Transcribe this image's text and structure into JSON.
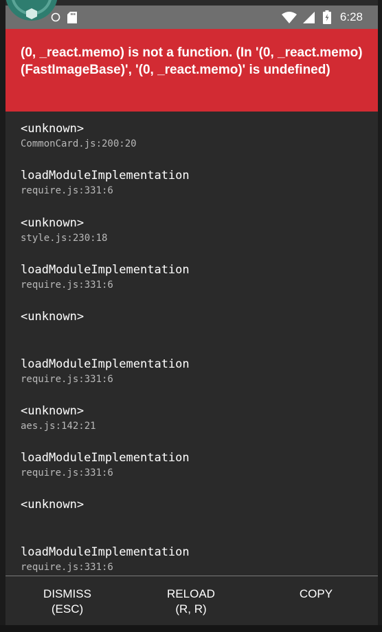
{
  "status_bar": {
    "time": "6:28",
    "icons": [
      "app-icon",
      "ring-icon",
      "sd-card-icon",
      "wifi-icon",
      "signal-icon",
      "battery-icon"
    ]
  },
  "error": {
    "message": "(0, _react.memo) is not a function. (In '(0, _react.memo)(FastImageBase)', '(0, _react.memo)' is undefined)"
  },
  "stack": [
    {
      "method": "<unknown>",
      "location": "CommonCard.js:200:20"
    },
    {
      "method": "loadModuleImplementation",
      "location": "require.js:331:6"
    },
    {
      "method": "<unknown>",
      "location": "style.js:230:18"
    },
    {
      "method": "loadModuleImplementation",
      "location": "require.js:331:6"
    },
    {
      "method": "<unknown>",
      "location": ""
    },
    {
      "method": "loadModuleImplementation",
      "location": "require.js:331:6"
    },
    {
      "method": "<unknown>",
      "location": "aes.js:142:21"
    },
    {
      "method": "loadModuleImplementation",
      "location": "require.js:331:6"
    },
    {
      "method": "<unknown>",
      "location": ""
    },
    {
      "method": "loadModuleImplementation",
      "location": "require.js:331:6"
    }
  ],
  "buttons": {
    "dismiss": {
      "line1": "DISMISS",
      "line2": "(ESC)"
    },
    "reload": {
      "line1": "RELOAD",
      "line2": "(R, R)"
    },
    "copy": {
      "line1": "COPY",
      "line2": ""
    }
  },
  "colors": {
    "error_red": "#d22b33",
    "background": "#2a2a2a",
    "status_bar": "#6f6f6f"
  }
}
